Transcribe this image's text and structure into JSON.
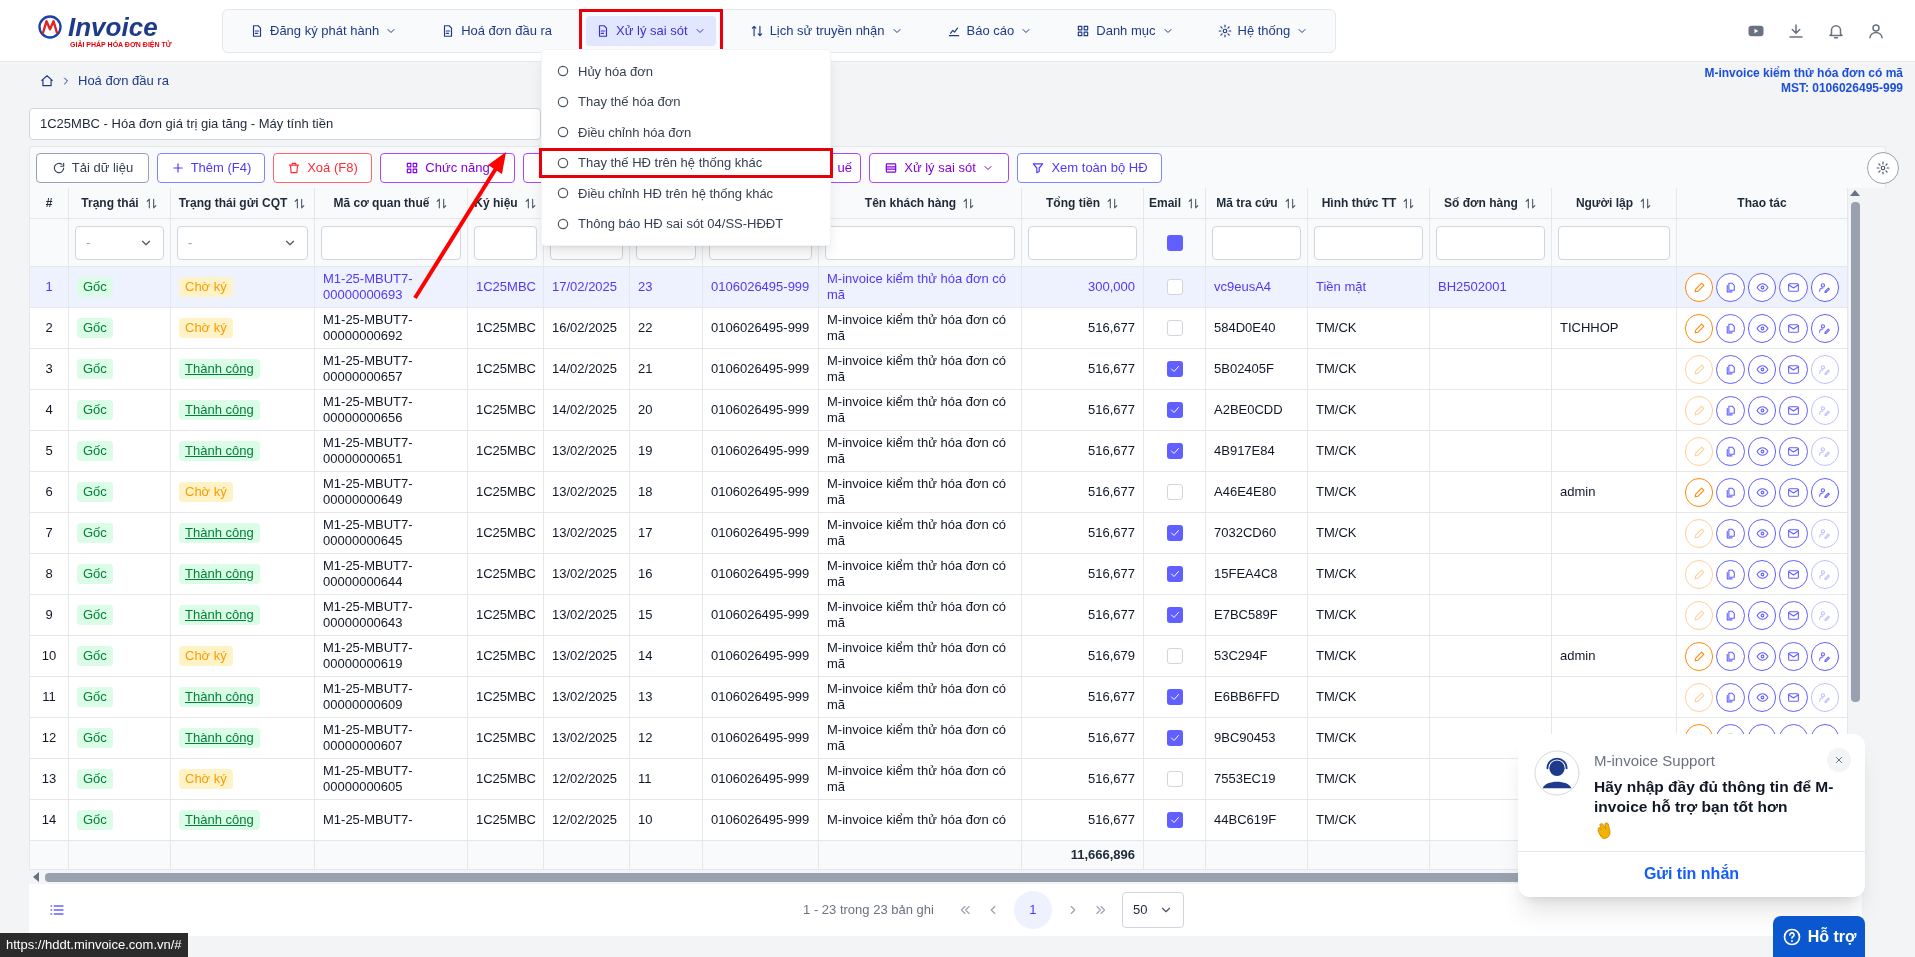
{
  "header": {
    "logo_text": "Invoice",
    "logo_tagline": "GIẢI PHÁP HÓA ĐƠN ĐIỆN TỬ",
    "nav": [
      {
        "label": "Đăng ký phát hành",
        "dropdown": true,
        "selected": false,
        "highlighted": false
      },
      {
        "label": "Hoá đơn đầu ra",
        "dropdown": false,
        "selected": false,
        "highlighted": false
      },
      {
        "label": "Xử lý sai sót",
        "dropdown": true,
        "selected": true,
        "highlighted": true
      },
      {
        "label": "Lịch sử truyền nhận",
        "dropdown": true,
        "selected": false,
        "highlighted": false
      },
      {
        "label": "Báo cáo",
        "dropdown": true,
        "selected": false,
        "highlighted": false
      },
      {
        "label": "Danh mục",
        "dropdown": true,
        "selected": false,
        "highlighted": false
      },
      {
        "label": "Hệ thống",
        "dropdown": true,
        "selected": false,
        "highlighted": false
      }
    ]
  },
  "menu": {
    "items": [
      {
        "label": "Hủy hóa đơn",
        "highlighted": false
      },
      {
        "label": "Thay thế hóa đơn",
        "highlighted": false
      },
      {
        "label": "Điều chỉnh hóa đơn",
        "highlighted": false
      },
      {
        "label": "Thay thế HĐ trên hệ thống khác",
        "highlighted": true
      },
      {
        "label": "Điều chỉnh HĐ trên hệ thống khác",
        "highlighted": false
      },
      {
        "label": "Thông báo HĐ sai sót 04/SS-HĐĐT",
        "highlighted": false
      }
    ]
  },
  "breadcrumb": [
    "Hoá đơn đầu ra"
  ],
  "company": {
    "name": "M-invoice kiểm thử hóa đơn có mã",
    "tax_id": "MST: 0106026495-999"
  },
  "template_select": {
    "value": "1C25MBC - Hóa đơn giá trị gia tăng - Máy tính tiền"
  },
  "toolbar": [
    {
      "label": "Tải dữ liệu",
      "kind": "reload"
    },
    {
      "label": "Thêm (F4)",
      "kind": "add"
    },
    {
      "label": "Xoá (F8)",
      "kind": "delete"
    },
    {
      "label": "Chức năng",
      "kind": "functions"
    },
    {
      "label": "uế",
      "kind": "partial"
    },
    {
      "label": "Xử lý sai sót",
      "kind": "errors"
    },
    {
      "label": "Xem toàn bộ HĐ",
      "kind": "filter"
    }
  ],
  "table": {
    "columns": [
      {
        "label": "#",
        "sortable": false
      },
      {
        "label": "Trạng thái",
        "sortable": true
      },
      {
        "label": "Trạng thái gửi CQT",
        "sortable": true
      },
      {
        "label": "Mã cơ quan thuế",
        "sortable": true
      },
      {
        "label": "Ký hiệu",
        "sortable": true
      },
      null,
      null,
      null,
      {
        "label": "Tên khách hàng",
        "sortable": true
      },
      {
        "label": "Tổng tiền",
        "sortable": true
      },
      {
        "label": "Email",
        "sortable": true
      },
      {
        "label": "Mã tra cứu",
        "sortable": true
      },
      {
        "label": "Hình thức TT",
        "sortable": true
      },
      {
        "label": "Số đơn hàng",
        "sortable": true
      },
      {
        "label": "Người lập",
        "sortable": true
      },
      {
        "label": "Thao tác",
        "sortable": false
      }
    ],
    "filters": [
      {
        "kind": "none"
      },
      {
        "kind": "select",
        "placeholder": "-"
      },
      {
        "kind": "select",
        "placeholder": "-"
      },
      {
        "kind": "text"
      },
      {
        "kind": "text"
      },
      {
        "kind": "text"
      },
      {
        "kind": "text"
      },
      {
        "kind": "text"
      },
      {
        "kind": "text"
      },
      {
        "kind": "text"
      },
      {
        "kind": "checkbox",
        "checked": true
      },
      {
        "kind": "text"
      },
      {
        "kind": "text"
      },
      {
        "kind": "text"
      },
      {
        "kind": "text"
      },
      {
        "kind": "none"
      }
    ],
    "rows": [
      {
        "no": "1",
        "status": {
          "text": "Gốc",
          "kind": "original"
        },
        "cqt": {
          "text": "Chờ ký",
          "kind": "pending"
        },
        "tax_code": "M1-25-MBUT7-00000000693",
        "series": "1C25MBC",
        "column_6": "17/02/2025",
        "column_7": "23",
        "column_8": "0106026495-999",
        "customer": "M-invoice kiểm thử hóa đơn có mã",
        "total": "300,000",
        "email_sent": false,
        "lookup_code": "vc9eusA4",
        "payment": "Tiền mặt",
        "order_no": "BH2502001",
        "editable": true,
        "selected": true
      },
      {
        "no": "2",
        "status": {
          "text": "Gốc",
          "kind": "original"
        },
        "cqt": {
          "text": "Chờ ký",
          "kind": "pending"
        },
        "tax_code": "M1-25-MBUT7-00000000692",
        "series": "1C25MBC",
        "column_6": "16/02/2025",
        "column_7": "22",
        "column_8": "0106026495-999",
        "customer": "M-invoice kiểm thử hóa đơn có mã",
        "total": "516,677",
        "email_sent": false,
        "lookup_code": "584D0E40",
        "payment": "TM/CK",
        "creator": "TICHHOP",
        "editable": true,
        "selected": false
      },
      {
        "no": "3",
        "status": {
          "text": "Gốc",
          "kind": "original"
        },
        "cqt": {
          "text": "Thành công",
          "kind": "success"
        },
        "tax_code": "M1-25-MBUT7-00000000657",
        "series": "1C25MBC",
        "column_6": "14/02/2025",
        "column_7": "21",
        "column_8": "0106026495-999",
        "customer": "M-invoice kiểm thử hóa đơn có mã",
        "total": "516,677",
        "email_sent": true,
        "lookup_code": "5B02405F",
        "payment": "TM/CK",
        "editable": false,
        "selected": false
      },
      {
        "no": "4",
        "status": {
          "text": "Gốc",
          "kind": "original"
        },
        "cqt": {
          "text": "Thành công",
          "kind": "success"
        },
        "tax_code": "M1-25-MBUT7-00000000656",
        "series": "1C25MBC",
        "column_6": "14/02/2025",
        "column_7": "20",
        "column_8": "0106026495-999",
        "customer": "M-invoice kiểm thử hóa đơn có mã",
        "total": "516,677",
        "email_sent": true,
        "lookup_code": "A2BE0CDD",
        "payment": "TM/CK",
        "editable": false,
        "selected": false
      },
      {
        "no": "5",
        "status": {
          "text": "Gốc",
          "kind": "original"
        },
        "cqt": {
          "text": "Thành công",
          "kind": "success"
        },
        "tax_code": "M1-25-MBUT7-00000000651",
        "series": "1C25MBC",
        "column_6": "13/02/2025",
        "column_7": "19",
        "column_8": "0106026495-999",
        "customer": "M-invoice kiểm thử hóa đơn có mã",
        "total": "516,677",
        "email_sent": true,
        "lookup_code": "4B917E84",
        "payment": "TM/CK",
        "editable": false,
        "selected": false
      },
      {
        "no": "6",
        "status": {
          "text": "Gốc",
          "kind": "original"
        },
        "cqt": {
          "text": "Chờ ký",
          "kind": "pending"
        },
        "tax_code": "M1-25-MBUT7-00000000649",
        "series": "1C25MBC",
        "column_6": "13/02/2025",
        "column_7": "18",
        "column_8": "0106026495-999",
        "customer": "M-invoice kiểm thử hóa đơn có mã",
        "total": "516,677",
        "email_sent": false,
        "lookup_code": "A46E4E80",
        "payment": "TM/CK",
        "creator": "admin",
        "editable": true,
        "selected": false
      },
      {
        "no": "7",
        "status": {
          "text": "Gốc",
          "kind": "original"
        },
        "cqt": {
          "text": "Thành công",
          "kind": "success"
        },
        "tax_code": "M1-25-MBUT7-00000000645",
        "series": "1C25MBC",
        "column_6": "13/02/2025",
        "column_7": "17",
        "column_8": "0106026495-999",
        "customer": "M-invoice kiểm thử hóa đơn có mã",
        "total": "516,677",
        "email_sent": true,
        "lookup_code": "7032CD60",
        "payment": "TM/CK",
        "editable": false,
        "selected": false
      },
      {
        "no": "8",
        "status": {
          "text": "Gốc",
          "kind": "original"
        },
        "cqt": {
          "text": "Thành công",
          "kind": "success"
        },
        "tax_code": "M1-25-MBUT7-00000000644",
        "series": "1C25MBC",
        "column_6": "13/02/2025",
        "column_7": "16",
        "column_8": "0106026495-999",
        "customer": "M-invoice kiểm thử hóa đơn có mã",
        "total": "516,677",
        "email_sent": true,
        "lookup_code": "15FEA4C8",
        "payment": "TM/CK",
        "editable": false,
        "selected": false
      },
      {
        "no": "9",
        "status": {
          "text": "Gốc",
          "kind": "original"
        },
        "cqt": {
          "text": "Thành công",
          "kind": "success"
        },
        "tax_code": "M1-25-MBUT7-00000000643",
        "series": "1C25MBC",
        "column_6": "13/02/2025",
        "column_7": "15",
        "column_8": "0106026495-999",
        "customer": "M-invoice kiểm thử hóa đơn có mã",
        "total": "516,677",
        "email_sent": true,
        "lookup_code": "E7BC589F",
        "payment": "TM/CK",
        "editable": false,
        "selected": false
      },
      {
        "no": "10",
        "status": {
          "text": "Gốc",
          "kind": "original"
        },
        "cqt": {
          "text": "Chờ ký",
          "kind": "pending"
        },
        "tax_code": "M1-25-MBUT7-00000000619",
        "series": "1C25MBC",
        "column_6": "13/02/2025",
        "column_7": "14",
        "column_8": "0106026495-999",
        "customer": "M-invoice kiểm thử hóa đơn có mã",
        "total": "516,679",
        "email_sent": false,
        "lookup_code": "53C294F",
        "payment": "TM/CK",
        "creator": "admin",
        "editable": true,
        "selected": false
      },
      {
        "no": "11",
        "status": {
          "text": "Gốc",
          "kind": "original"
        },
        "cqt": {
          "text": "Thành công",
          "kind": "success"
        },
        "tax_code": "M1-25-MBUT7-00000000609",
        "series": "1C25MBC",
        "column_6": "13/02/2025",
        "column_7": "13",
        "column_8": "0106026495-999",
        "customer": "M-invoice kiểm thử hóa đơn có mã",
        "total": "516,677",
        "email_sent": true,
        "lookup_code": "E6BB6FFD",
        "payment": "TM/CK",
        "editable": false,
        "selected": false
      },
      {
        "no": "12",
        "status": {
          "text": "Gốc",
          "kind": "original"
        },
        "cqt": {
          "text": "Thành công",
          "kind": "success"
        },
        "tax_code": "M1-25-MBUT7-00000000607",
        "series": "1C25MBC",
        "column_6": "13/02/2025",
        "column_7": "12",
        "column_8": "0106026495-999",
        "customer": "M-invoice kiểm thử hóa đơn có mã",
        "total": "516,677",
        "email_sent": true,
        "lookup_code": "9BC90453",
        "payment": "TM/CK",
        "selected": false
      },
      {
        "no": "13",
        "status": {
          "text": "Gốc",
          "kind": "original"
        },
        "cqt": {
          "text": "Chờ ký",
          "kind": "pending"
        },
        "tax_code": "M1-25-MBUT7-00000000605",
        "series": "1C25MBC",
        "column_6": "12/02/2025",
        "column_7": "11",
        "column_8": "0106026495-999",
        "customer": "M-invoice kiểm thử hóa đơn có mã",
        "total": "516,677",
        "email_sent": false,
        "lookup_code": "7553EC19",
        "payment": "TM/CK",
        "selected": false
      },
      {
        "no": "14",
        "status": {
          "text": "Gốc",
          "kind": "original"
        },
        "cqt": {
          "text": "Thành công",
          "kind": "success"
        },
        "tax_code": "M1-25-MBUT7-",
        "series": "1C25MBC",
        "column_6": "12/02/2025",
        "column_7": "10",
        "column_8": "0106026495-999",
        "customer": "M-invoice kiểm thử hóa đơn có",
        "total": "516,677",
        "email_sent": true,
        "lookup_code": "44BC619F",
        "payment": "TM/CK",
        "selected": false
      }
    ],
    "footer_total": "11,666,896"
  },
  "pagination": {
    "summary": "1 - 23 trong 23 bản ghi",
    "pages": [
      {
        "label": "1",
        "selected": true
      }
    ],
    "page_size": "50"
  },
  "support": {
    "title": "M-invoice Support",
    "message": "Hãy nhập đầy đủ thông tin để M-invoice hỗ trợ bạn tốt hơn",
    "action": "Gửi tin nhắn"
  },
  "help_button": "Hỗ trợ",
  "status_url": "https://hddt.minvoice.com.vn/#"
}
